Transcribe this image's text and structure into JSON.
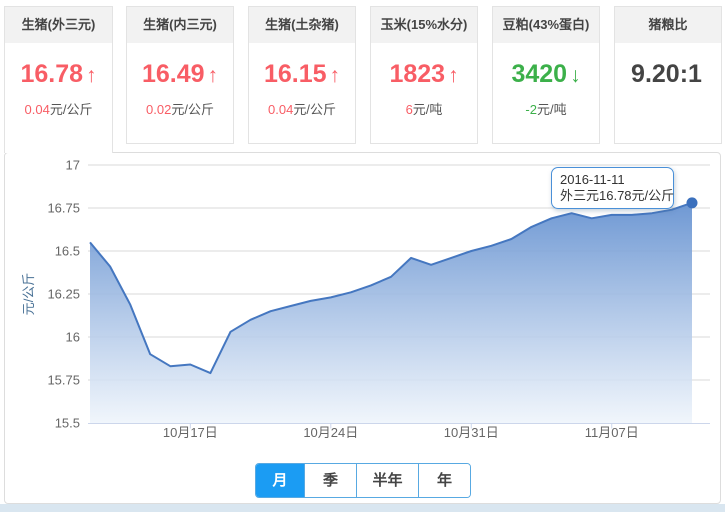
{
  "cards": [
    {
      "title": "生猪(外三元)",
      "value": "16.78",
      "trend": "up",
      "change": "0.04",
      "unit": "元/公斤",
      "active": true
    },
    {
      "title": "生猪(内三元)",
      "value": "16.49",
      "trend": "up",
      "change": "0.02",
      "unit": "元/公斤"
    },
    {
      "title": "生猪(土杂猪)",
      "value": "16.15",
      "trend": "up",
      "change": "0.04",
      "unit": "元/公斤"
    },
    {
      "title": "玉米(15%水分)",
      "value": "1823",
      "trend": "up",
      "change": "6",
      "unit": "元/吨"
    },
    {
      "title": "豆粕(43%蛋白)",
      "value": "3420",
      "trend": "down",
      "change": "-2",
      "unit": "元/吨"
    },
    {
      "title": "猪粮比",
      "value": "9.20:1",
      "trend": "none",
      "change": "",
      "unit": ""
    }
  ],
  "icons": {
    "up_arrow": "↑",
    "down_arrow": "↓"
  },
  "colors": {
    "up": "#f85d65",
    "down": "#3cb04a",
    "neutral": "#444444",
    "line": "#4577c0",
    "area_top": "#4d80c9",
    "area_bottom": "#eef4fb",
    "marker": "#3b70bd",
    "grid": "#d9d9d9",
    "axis": "#ccd6eb",
    "tick_label": "#666666",
    "axis_title": "#4a7296",
    "tab_active_bg": "#1b9cf3",
    "tab_border": "#58a9e2",
    "tooltip_border": "#4a90d8"
  },
  "tooltip": {
    "line1": "2016-11-11",
    "line2": "外三元16.78元/公斤"
  },
  "tabs": [
    {
      "label": "月",
      "active": true
    },
    {
      "label": "季",
      "active": false
    },
    {
      "label": "半年",
      "active": false
    },
    {
      "label": "年",
      "active": false
    }
  ],
  "chart_data": {
    "type": "area",
    "title": "",
    "xlabel": "",
    "ylabel": "元/公斤",
    "ylim": [
      15.5,
      17
    ],
    "grid": true,
    "legend": "none",
    "y_tick_labels": [
      "17",
      "16.75",
      "16.5",
      "16.25",
      "16",
      "15.75",
      "15.5"
    ],
    "y_tick_values": [
      17,
      16.75,
      16.5,
      16.25,
      16,
      15.75,
      15.5
    ],
    "x_tick_labels": [
      {
        "index": 5,
        "label": "10月17日"
      },
      {
        "index": 12,
        "label": "10月24日"
      },
      {
        "index": 19,
        "label": "10月31日"
      },
      {
        "index": 26,
        "label": "11月07日"
      }
    ],
    "series": [
      {
        "name": "外三元",
        "last_point_date": "2016-11-11",
        "values": [
          16.55,
          16.41,
          16.19,
          15.9,
          15.83,
          15.84,
          15.79,
          16.03,
          16.1,
          16.15,
          16.18,
          16.21,
          16.23,
          16.26,
          16.3,
          16.35,
          16.46,
          16.42,
          16.46,
          16.5,
          16.53,
          16.57,
          16.64,
          16.69,
          16.72,
          16.69,
          16.71,
          16.71,
          16.72,
          16.74,
          16.78
        ]
      }
    ]
  }
}
